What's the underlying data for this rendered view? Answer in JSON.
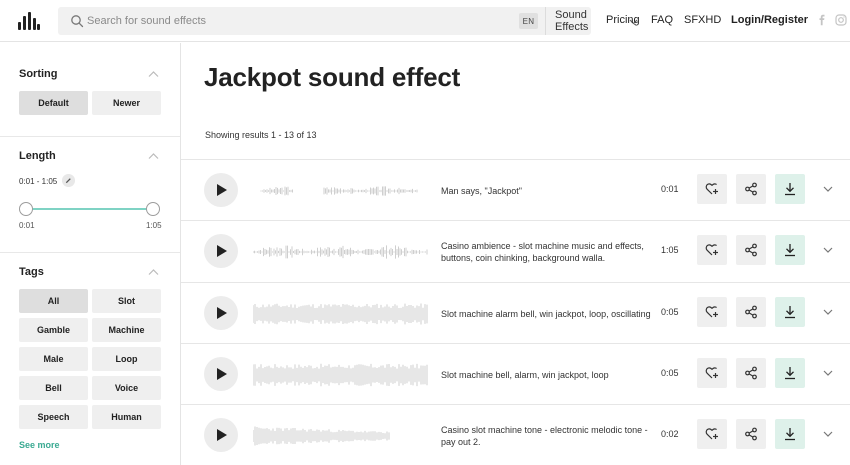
{
  "header": {
    "search_placeholder": "Search for sound effects",
    "language": "EN",
    "category": "Sound Effects",
    "nav": {
      "pricing": "Pricing",
      "faq": "FAQ",
      "sfxhd": "SFXHD",
      "login": "Login/Register"
    },
    "icons": {
      "logo": "waveform-logo-icon",
      "search": "search-icon",
      "facebook": "facebook-icon",
      "instagram": "instagram-icon"
    }
  },
  "sidebar": {
    "sorting": {
      "title": "Sorting",
      "options": [
        "Default",
        "Newer"
      ],
      "selected": "Default"
    },
    "length": {
      "title": "Length",
      "range": "0:01 - 1:05",
      "min_label": "0:01",
      "max_label": "1:05"
    },
    "tags": {
      "title": "Tags",
      "items": [
        "All",
        "Slot",
        "Gamble",
        "Machine",
        "Male",
        "Loop",
        "Bell",
        "Voice",
        "Speech",
        "Human"
      ],
      "selected": "All",
      "see_more": "See more"
    }
  },
  "main": {
    "title": "Jackpot sound effect",
    "result_count": "Showing results 1 - 13 of 13",
    "results": [
      {
        "description": "Man says, \"Jackpot\"",
        "duration": "0:01"
      },
      {
        "description": "Casino ambience - slot machine music and effects, buttons, coin chinking, background walla.",
        "duration": "1:05"
      },
      {
        "description": "Slot machine alarm bell, win jackpot, loop, oscillating",
        "duration": "0:05"
      },
      {
        "description": "Slot machine bell, alarm, win jackpot, loop",
        "duration": "0:05"
      },
      {
        "description": "Casino slot machine tone - electronic melodic tone - pay out 2.",
        "duration": "0:02"
      }
    ]
  },
  "colors": {
    "accent": "#3aaa92",
    "slider": "#7fd3c4",
    "download_bg": "#def1ea",
    "waveform": "#cfcfcf"
  }
}
